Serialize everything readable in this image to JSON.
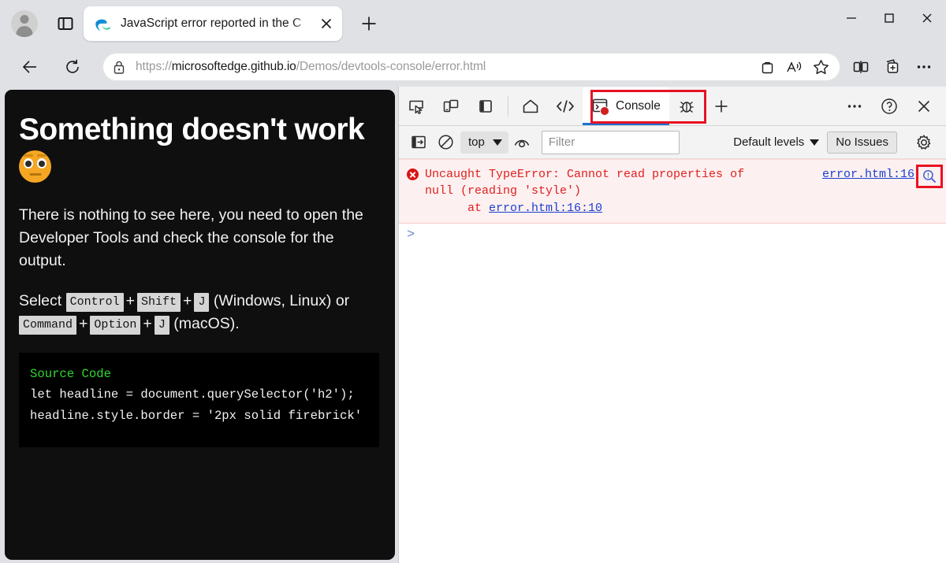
{
  "browser": {
    "profile_icon": "avatar-icon",
    "tab_actions_icon": "tab-actions-icon",
    "tab": {
      "title": "JavaScript error reported in the C",
      "favicon": "edge-logo-icon",
      "close_label": "Close tab"
    },
    "new_tab_label": "New tab",
    "window_controls": {
      "minimize": "Minimize",
      "maximize": "Maximize",
      "close": "Close"
    },
    "nav": {
      "back": "Back",
      "reload": "Refresh",
      "lock_icon": "lock-icon",
      "url_prefix": "https://",
      "url_host": "microsoftedge.github.io",
      "url_path": "/Demos/devtools-console/error.html",
      "split_screen": "Split screen",
      "collections": "Collections",
      "settings_more": "Settings and more",
      "shopping_icon": "shopping-bag-icon",
      "read_aloud_icon": "read-aloud-icon",
      "favorite_icon": "star-icon"
    }
  },
  "page": {
    "heading": "Something doesn't work",
    "heading_emoji": "face-with-rolling-eyes-emoji",
    "paragraph": "There is nothing to see here, you need to open the Developer Tools and check the console for the output.",
    "shortcut": {
      "lead": "Select",
      "win_keys": [
        "Control",
        "Shift",
        "J"
      ],
      "win_label": "(Windows, Linux) or",
      "mac_keys": [
        "Command",
        "Option",
        "J"
      ],
      "mac_label": "(macOS).",
      "plus": "+"
    },
    "code": {
      "title": "Source Code",
      "line1": "let headline = document.querySelector('h2');",
      "line2": "headline.style.border = '2px solid firebrick'"
    }
  },
  "devtools": {
    "toolbar": {
      "inspect_icon": "inspect-element-icon",
      "device_icon": "device-emulation-icon",
      "dock_icon": "dock-side-icon",
      "home_icon": "home-icon",
      "elements_icon": "elements-code-icon",
      "console_tab": "Console",
      "console_icon": "console-icon",
      "console_error_badge": "",
      "bug_icon": "issues-bug-icon",
      "more_tabs_icon": "add-panel-icon",
      "more_options_icon": "more-tools-icon",
      "help_icon": "help-icon",
      "close_icon": "close-devtools-icon"
    },
    "filterbar": {
      "sidebar_toggle_icon": "console-sidebar-icon",
      "clear_icon": "clear-console-icon",
      "context": "top",
      "live_expression_icon": "eye-icon",
      "filter_placeholder": "Filter",
      "filter_value": "",
      "levels": "Default levels",
      "issues": "No Issues",
      "settings_icon": "settings-gear-icon"
    },
    "console": {
      "error": {
        "message_line1": "Uncaught TypeError: Cannot read properties of",
        "message_line2": "null (reading 'style')",
        "stack_prefix": "at ",
        "stack_link": "error.html:16:10",
        "source_link": "error.html:16",
        "magnify_icon": "search-magnifier-icon"
      },
      "prompt": ">"
    }
  },
  "colors": {
    "accent_blue": "#1a6fd4",
    "error_red": "#e02020",
    "highlight_red": "#e81123",
    "link_blue": "#1a3fcf",
    "code_green": "#2fd92f",
    "chrome_gray": "#dfe1e5"
  }
}
